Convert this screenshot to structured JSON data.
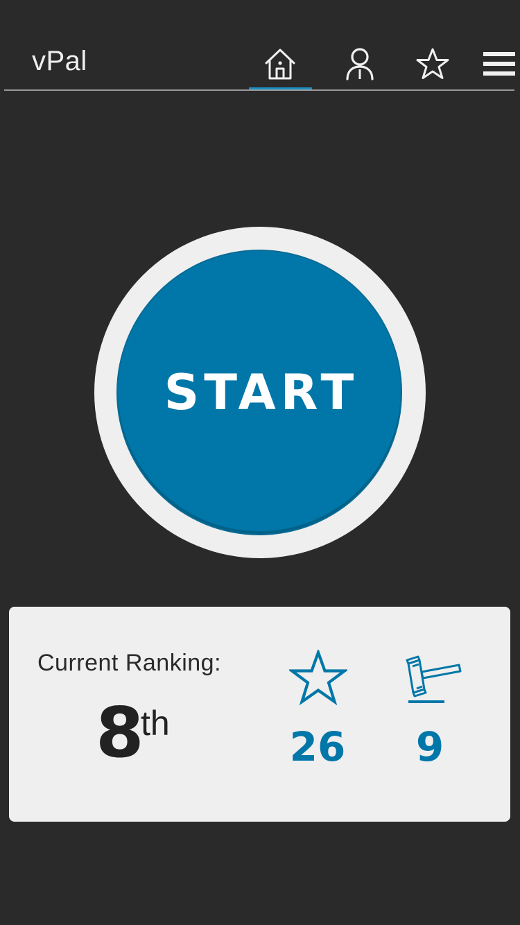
{
  "header": {
    "title": "vPal",
    "nav": {
      "home_icon": "home-icon",
      "profile_icon": "user-icon",
      "favorites_icon": "star-icon",
      "menu_icon": "hamburger-menu-icon",
      "active_tab": "home"
    }
  },
  "main": {
    "start_label": "START"
  },
  "stats": {
    "ranking_label": "Current Ranking:",
    "ranking_number": "8",
    "ranking_suffix": "th",
    "stars_icon": "star-icon",
    "stars_count": "26",
    "votes_icon": "gavel-icon",
    "votes_count": "9"
  },
  "colors": {
    "background": "#2a2a2b",
    "accent": "#0077a8",
    "accent_active_tab": "#1a8fc4",
    "card": "#efefef",
    "text_light": "#f0f0f0"
  }
}
